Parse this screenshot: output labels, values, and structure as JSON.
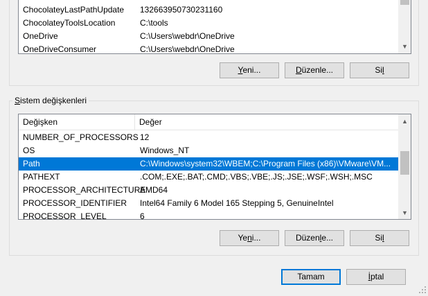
{
  "user_vars": {
    "rows": [
      {
        "name": "ChocolateyLastPathUpdate",
        "value": "132663950730231160"
      },
      {
        "name": "ChocolateyToolsLocation",
        "value": "C:\\tools"
      },
      {
        "name": "OneDrive",
        "value": "C:\\Users\\webdr\\OneDrive"
      },
      {
        "name": "OneDriveConsumer",
        "value": "C:\\Users\\webdr\\OneDrive"
      }
    ],
    "buttons": {
      "new_a": "Y",
      "new_b": "eni...",
      "edit_a": "D",
      "edit_b": "üzenle...",
      "del_a": "Si",
      "del_b": "l"
    }
  },
  "system_vars": {
    "legend_a": "S",
    "legend_b": "istem değişkenleri",
    "col_name": "Değişken",
    "col_value": "Değer",
    "rows": [
      {
        "name": "NUMBER_OF_PROCESSORS",
        "value": "12"
      },
      {
        "name": "OS",
        "value": "Windows_NT"
      },
      {
        "name": "Path",
        "value": "C:\\Windows\\system32\\WBEM;C:\\Program Files (x86)\\VMware\\VM..."
      },
      {
        "name": "PATHEXT",
        "value": ".COM;.EXE;.BAT;.CMD;.VBS;.VBE;.JS;.JSE;.WSF;.WSH;.MSC"
      },
      {
        "name": "PROCESSOR_ARCHITECTURE",
        "value": "AMD64"
      },
      {
        "name": "PROCESSOR_IDENTIFIER",
        "value": "Intel64 Family 6 Model 165 Stepping 5, GenuineIntel"
      },
      {
        "name": "PROCESSOR_LEVEL",
        "value": "6"
      }
    ],
    "selected_row": "Path",
    "buttons": {
      "new_a": "Ye",
      "new_b": "n",
      "new_c": "i...",
      "edit_a": "Düzen",
      "edit_b": "l",
      "edit_c": "e...",
      "del_a": "Si",
      "del_b": "l"
    }
  },
  "dialog": {
    "ok": "Tamam",
    "cancel_a": "İ",
    "cancel_b": "ptal"
  },
  "icons": {
    "scroll_up": "chevron-up-icon",
    "scroll_down": "chevron-down-icon"
  },
  "colors": {
    "selection": "#0078d7",
    "default_button_border": "#0078d7"
  }
}
